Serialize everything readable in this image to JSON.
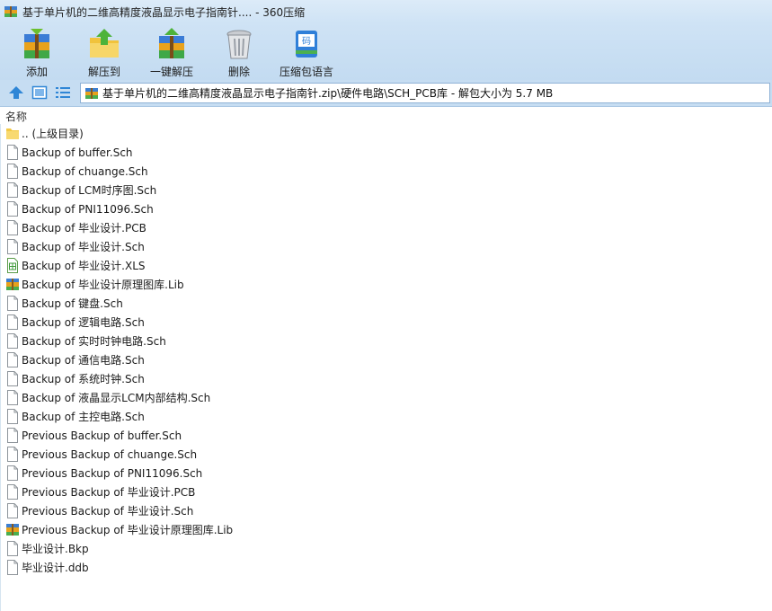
{
  "window": {
    "title": "基于单片机的二维高精度液晶显示电子指南针.... - 360压缩"
  },
  "toolbar": {
    "items": [
      {
        "label": "添加",
        "icon": "add-archive-icon"
      },
      {
        "label": "解压到",
        "icon": "extract-to-icon"
      },
      {
        "label": "一键解压",
        "icon": "one-click-extract-icon"
      },
      {
        "label": "删除",
        "icon": "delete-icon"
      },
      {
        "label": "压缩包语言",
        "icon": "archive-language-icon"
      }
    ]
  },
  "address": {
    "path": "基于单片机的二维高精度液晶显示电子指南针.zip\\硬件电路\\SCH_PCB库 - 解包大小为 5.7 MB"
  },
  "list": {
    "header_name": "名称",
    "files": [
      {
        "name": ".. (上级目录)",
        "icon": "folder"
      },
      {
        "name": "Backup of buffer.Sch",
        "icon": "file"
      },
      {
        "name": "Backup of chuange.Sch",
        "icon": "file"
      },
      {
        "name": "Backup of LCM时序图.Sch",
        "icon": "file"
      },
      {
        "name": "Backup of PNI11096.Sch",
        "icon": "file"
      },
      {
        "name": "Backup of 毕业设计.PCB",
        "icon": "file"
      },
      {
        "name": "Backup of 毕业设计.Sch",
        "icon": "file"
      },
      {
        "name": "Backup of 毕业设计.XLS",
        "icon": "spreadsheet"
      },
      {
        "name": "Backup of 毕业设计原理图库.Lib",
        "icon": "archive"
      },
      {
        "name": "Backup of 键盘.Sch",
        "icon": "file"
      },
      {
        "name": "Backup of 逻辑电路.Sch",
        "icon": "file"
      },
      {
        "name": "Backup of 实时时钟电路.Sch",
        "icon": "file"
      },
      {
        "name": "Backup of 通信电路.Sch",
        "icon": "file"
      },
      {
        "name": "Backup of 系统时钟.Sch",
        "icon": "file"
      },
      {
        "name": "Backup of 液晶显示LCM内部结构.Sch",
        "icon": "file"
      },
      {
        "name": "Backup of 主控电路.Sch",
        "icon": "file"
      },
      {
        "name": "Previous Backup of buffer.Sch",
        "icon": "file"
      },
      {
        "name": "Previous Backup of chuange.Sch",
        "icon": "file"
      },
      {
        "name": "Previous Backup of PNI11096.Sch",
        "icon": "file"
      },
      {
        "name": "Previous Backup of 毕业设计.PCB",
        "icon": "file"
      },
      {
        "name": "Previous Backup of 毕业设计.Sch",
        "icon": "file"
      },
      {
        "name": "Previous Backup of 毕业设计原理图库.Lib",
        "icon": "archive"
      },
      {
        "name": "毕业设计.Bkp",
        "icon": "file"
      },
      {
        "name": "毕业设计.ddb",
        "icon": "file"
      }
    ]
  }
}
